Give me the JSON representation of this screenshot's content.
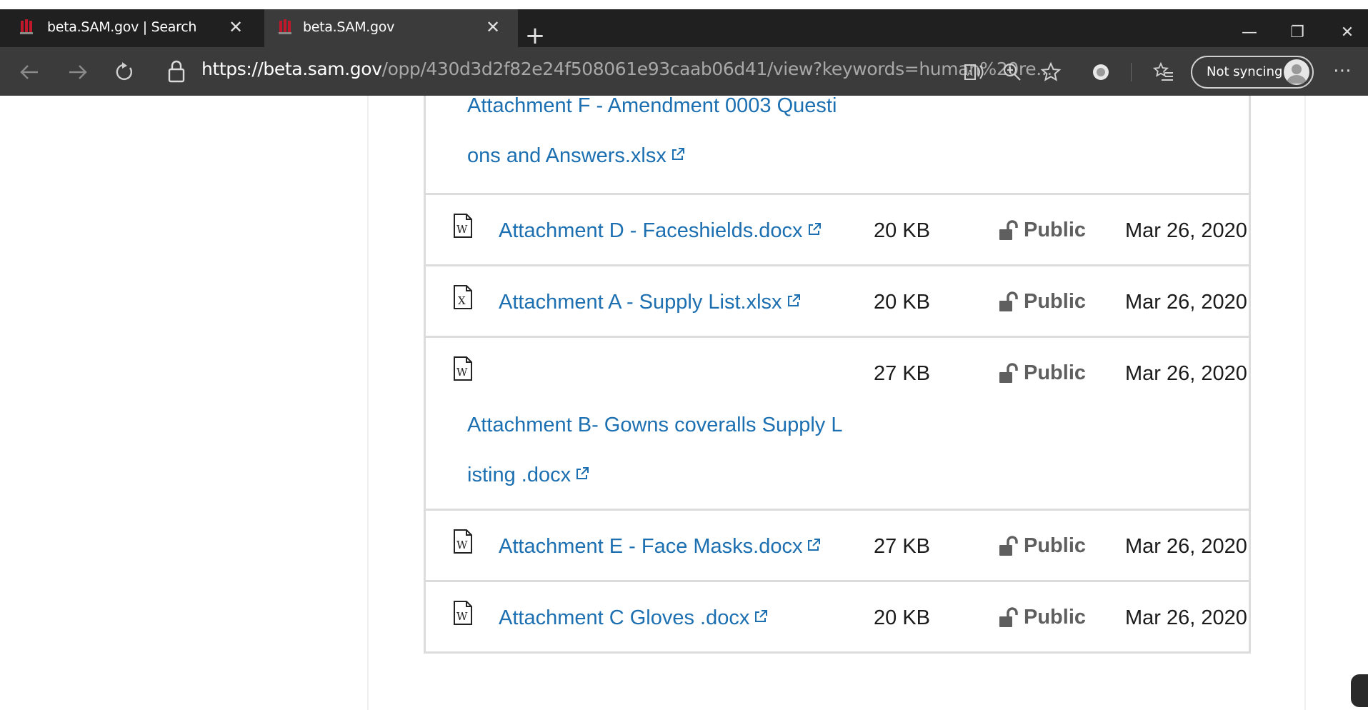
{
  "browser": {
    "tabs": [
      {
        "title": "beta.SAM.gov | Search",
        "active": false
      },
      {
        "title": "beta.SAM.gov",
        "active": true
      }
    ],
    "address": {
      "scheme": "https://",
      "host": "beta.sam.gov",
      "path": "/opp/430d3d2f82e24f508061e93caab06d41/view?keywords=human%20re..."
    },
    "sync_label": "Not syncing",
    "colors": {
      "chrome_dark": "#202020",
      "toolbar": "#3b3b3b",
      "favicon": "#c0182b"
    }
  },
  "attachments": {
    "colors": {
      "link": "#1c6fb0",
      "access": "#5f5f5f",
      "border": "#dcdcdc"
    },
    "rows": [
      {
        "line1": "Attachment F - Amendment 0003 Questi",
        "line2": "ons and Answers.xlsx",
        "icon": "excel-file-icon",
        "size": "",
        "access": "",
        "date": ""
      },
      {
        "name": "Attachment D - Faceshields.docx",
        "icon": "word-file-icon",
        "size": "20 KB",
        "access": "Public",
        "date": "Mar 26, 2020"
      },
      {
        "name": "Attachment A - Supply List.xlsx",
        "icon": "excel-file-icon",
        "size": "20 KB",
        "access": "Public",
        "date": "Mar 26, 2020"
      },
      {
        "line1": "Attachment B- Gowns coveralls Supply L",
        "line2": "isting .docx",
        "icon": "word-file-icon",
        "size": "27 KB",
        "access": "Public",
        "date": "Mar 26, 2020"
      },
      {
        "name": "Attachment E - Face Masks.docx",
        "icon": "word-file-icon",
        "size": "27 KB",
        "access": "Public",
        "date": "Mar 26, 2020"
      },
      {
        "name": "Attachment C Gloves .docx",
        "icon": "word-file-icon",
        "size": "20 KB",
        "access": "Public",
        "date": "Mar 26, 2020"
      }
    ]
  }
}
